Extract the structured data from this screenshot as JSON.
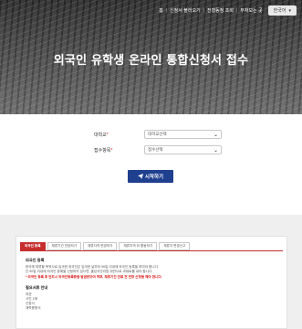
{
  "topnav": {
    "items": [
      "홈",
      "신청서 불러오기",
      "전형동정 조회",
      "부처모는 곳"
    ],
    "language": {
      "label": "한국어"
    }
  },
  "hero": {
    "title": "외국인 유학생 온라인 통합신청서 접수"
  },
  "form": {
    "university": {
      "label": "대학교",
      "required_mark": "*",
      "value": "대학교선택"
    },
    "admission": {
      "label": "접수항목",
      "required_mark": "*",
      "value": "접수선택"
    },
    "start_button": {
      "label": "시작하기",
      "icon": "paper-plane-icon"
    }
  },
  "tabs": [
    {
      "label": "외국인 등록",
      "active": true
    },
    {
      "label": "체류기간 연장허가",
      "active": false
    },
    {
      "label": "체류자격 변경허가",
      "active": false
    },
    {
      "label": "체류자격 외 활동허가",
      "active": false
    },
    {
      "label": "체류지 변경신고",
      "active": false
    }
  ],
  "content": {
    "heading1": "외국인 등록",
    "para1": "한국에 체류할 목적으로 입국한 외국인은 입국한 날부터 90일 이내에 외국인 등록을 하여야 합니다.",
    "para2": "단 90일 이내에 외국인 등록을 신청하지 않으면, 출입국관리법 위반으로 과태료를 내야 합니다.",
    "warning": "* 외국인 등록 후 반드시 외국인등록증을 발급받아야 하며, 체류기간 만료 전 연장 신청을 해야 합니다.",
    "heading2": "필요서류 안내",
    "items": [
      "여권",
      "사진 1매",
      "신청서",
      "재학증명서"
    ]
  },
  "colors": {
    "accent_red": "#c62d2d",
    "button_blue": "#1f3f8f",
    "warning_red": "#d81e1e"
  }
}
